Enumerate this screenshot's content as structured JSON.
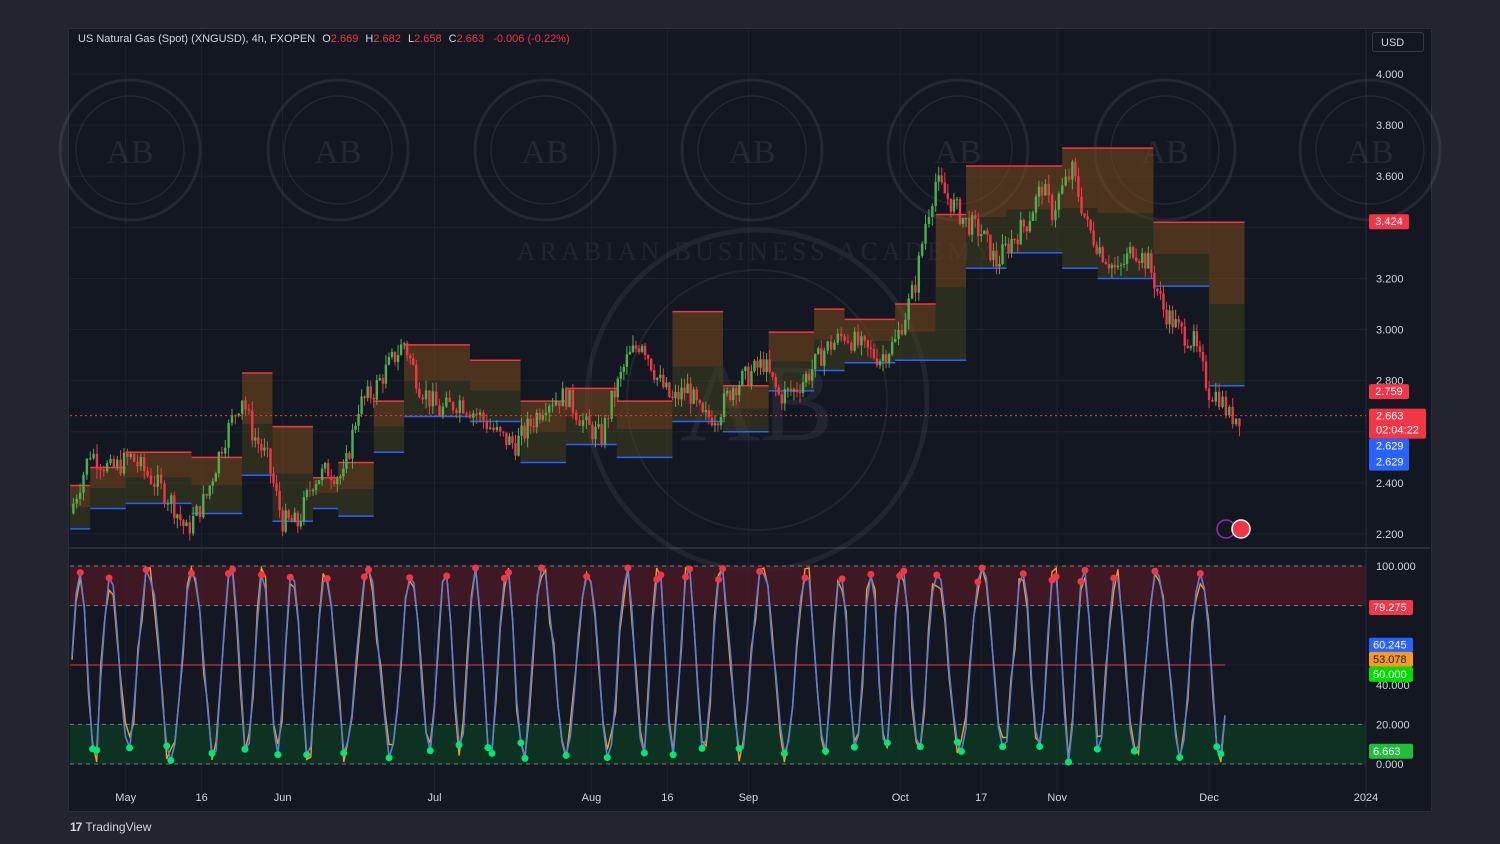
{
  "header": {
    "symbol": "US Natural Gas (Spot) (XNGUSD), 4h, FXOPEN",
    "o_label": "O",
    "o": "2.669",
    "h_label": "H",
    "h": "2.682",
    "l_label": "L",
    "l": "2.658",
    "c_label": "C",
    "c": "2.663",
    "change": "-0.006 (-0.22%)"
  },
  "currency": "USD",
  "brand": {
    "logo": "17",
    "name": "TradingView"
  },
  "watermark": {
    "initials": "AB",
    "text": "ARABIAN BUSINESS ACADEMY"
  },
  "colors": {
    "up": "#26a69a",
    "up_candle": "#4caf50",
    "down": "#f23645",
    "bg": "#131722",
    "oscillator_k": "#5b7fd4",
    "oscillator_d": "#f59b23",
    "zone_fill": "#7a4a1a",
    "overbought_zone": "#4a1a25",
    "oversold_zone": "#0e3a22"
  },
  "chart_data": [
    {
      "type": "candlestick",
      "title": "US Natural Gas (Spot) (XNGUSD), 4h, FXOPEN",
      "ylim": [
        2.2,
        4.1
      ],
      "yticks": [
        "4.000",
        "3.800",
        "3.600",
        "3.400",
        "3.200",
        "3.000",
        "2.800",
        "2.600",
        "2.400",
        "2.200"
      ],
      "xticks": [
        "May",
        "16",
        "Jun",
        "Jul",
        "Aug",
        "16",
        "Sep",
        "Oct",
        "17",
        "Nov",
        "Dec",
        "2024"
      ],
      "xtick_dates": [
        "2023-05-01",
        "2023-05-16",
        "2023-06-01",
        "2023-07-01",
        "2023-08-01",
        "2023-08-16",
        "2023-09-01",
        "2023-10-01",
        "2023-10-17",
        "2023-11-01",
        "2023-12-01",
        "2024-01-01"
      ],
      "close_path": [
        [
          "2023-04-20",
          2.28
        ],
        [
          "2023-04-24",
          2.52
        ],
        [
          "2023-04-28",
          2.45
        ],
        [
          "2023-05-02",
          2.5
        ],
        [
          "2023-05-06",
          2.42
        ],
        [
          "2023-05-10",
          2.33
        ],
        [
          "2023-05-13",
          2.21
        ],
        [
          "2023-05-17",
          2.35
        ],
        [
          "2023-05-20",
          2.55
        ],
        [
          "2023-05-24",
          2.74
        ],
        [
          "2023-05-26",
          2.6
        ],
        [
          "2023-05-29",
          2.49
        ],
        [
          "2023-06-01",
          2.25
        ],
        [
          "2023-06-04",
          2.24
        ],
        [
          "2023-06-07",
          2.41
        ],
        [
          "2023-06-10",
          2.45
        ],
        [
          "2023-06-13",
          2.42
        ],
        [
          "2023-06-16",
          2.7
        ],
        [
          "2023-06-19",
          2.76
        ],
        [
          "2023-06-22",
          2.86
        ],
        [
          "2023-06-25",
          2.95
        ],
        [
          "2023-06-28",
          2.78
        ],
        [
          "2023-07-02",
          2.68
        ],
        [
          "2023-07-06",
          2.72
        ],
        [
          "2023-07-10",
          2.66
        ],
        [
          "2023-07-14",
          2.58
        ],
        [
          "2023-07-17",
          2.55
        ],
        [
          "2023-07-20",
          2.63
        ],
        [
          "2023-07-23",
          2.72
        ],
        [
          "2023-07-27",
          2.74
        ],
        [
          "2023-07-31",
          2.62
        ],
        [
          "2023-08-03",
          2.58
        ],
        [
          "2023-08-05",
          2.72
        ],
        [
          "2023-08-08",
          2.88
        ],
        [
          "2023-08-11",
          2.96
        ],
        [
          "2023-08-14",
          2.81
        ],
        [
          "2023-08-17",
          2.72
        ],
        [
          "2023-08-20",
          2.77
        ],
        [
          "2023-08-23",
          2.65
        ],
        [
          "2023-08-26",
          2.67
        ],
        [
          "2023-08-29",
          2.78
        ],
        [
          "2023-09-01",
          2.82
        ],
        [
          "2023-09-04",
          2.87
        ],
        [
          "2023-09-07",
          2.74
        ],
        [
          "2023-09-10",
          2.76
        ],
        [
          "2023-09-13",
          2.83
        ],
        [
          "2023-09-16",
          2.92
        ],
        [
          "2023-09-20",
          2.98
        ],
        [
          "2023-09-24",
          2.92
        ],
        [
          "2023-09-27",
          2.89
        ],
        [
          "2023-09-30",
          2.95
        ],
        [
          "2023-10-02",
          3.06
        ],
        [
          "2023-10-04",
          3.18
        ],
        [
          "2023-10-06",
          3.42
        ],
        [
          "2023-10-08",
          3.58
        ],
        [
          "2023-10-11",
          3.5
        ],
        [
          "2023-10-14",
          3.42
        ],
        [
          "2023-10-17",
          3.38
        ],
        [
          "2023-10-20",
          3.26
        ],
        [
          "2023-10-23",
          3.35
        ],
        [
          "2023-10-26",
          3.42
        ],
        [
          "2023-10-29",
          3.56
        ],
        [
          "2023-10-31",
          3.46
        ],
        [
          "2023-11-02",
          3.55
        ],
        [
          "2023-11-04",
          3.62
        ],
        [
          "2023-11-07",
          3.4
        ],
        [
          "2023-11-10",
          3.3
        ],
        [
          "2023-11-13",
          3.22
        ],
        [
          "2023-11-16",
          3.32
        ],
        [
          "2023-11-19",
          3.26
        ],
        [
          "2023-11-22",
          3.08
        ],
        [
          "2023-11-25",
          3.0
        ],
        [
          "2023-11-28",
          2.95
        ],
        [
          "2023-12-01",
          2.76
        ],
        [
          "2023-12-03",
          2.74
        ],
        [
          "2023-12-05",
          2.66
        ],
        [
          "2023-12-07",
          2.663
        ]
      ],
      "zones": [
        {
          "start": "2023-04-20",
          "end": "2023-04-24",
          "high": 2.39,
          "low": 2.22
        },
        {
          "start": "2023-04-24",
          "end": "2023-05-01",
          "high": 2.46,
          "low": 2.3
        },
        {
          "start": "2023-05-01",
          "end": "2023-05-14",
          "high": 2.52,
          "low": 2.32
        },
        {
          "start": "2023-05-14",
          "end": "2023-05-24",
          "high": 2.5,
          "low": 2.28
        },
        {
          "start": "2023-05-24",
          "end": "2023-05-30",
          "high": 2.83,
          "low": 2.43
        },
        {
          "start": "2023-05-30",
          "end": "2023-06-07",
          "high": 2.62,
          "low": 2.25
        },
        {
          "start": "2023-06-07",
          "end": "2023-06-12",
          "high": 2.42,
          "low": 2.3
        },
        {
          "start": "2023-06-12",
          "end": "2023-06-19",
          "high": 2.48,
          "low": 2.27
        },
        {
          "start": "2023-06-19",
          "end": "2023-06-25",
          "high": 2.72,
          "low": 2.52
        },
        {
          "start": "2023-06-25",
          "end": "2023-07-08",
          "high": 2.94,
          "low": 2.66
        },
        {
          "start": "2023-07-08",
          "end": "2023-07-18",
          "high": 2.88,
          "low": 2.64
        },
        {
          "start": "2023-07-18",
          "end": "2023-07-27",
          "high": 2.72,
          "low": 2.48
        },
        {
          "start": "2023-07-27",
          "end": "2023-08-06",
          "high": 2.77,
          "low": 2.55
        },
        {
          "start": "2023-08-06",
          "end": "2023-08-17",
          "high": 2.72,
          "low": 2.5
        },
        {
          "start": "2023-08-17",
          "end": "2023-08-27",
          "high": 3.07,
          "low": 2.64
        },
        {
          "start": "2023-08-27",
          "end": "2023-09-05",
          "high": 2.78,
          "low": 2.6
        },
        {
          "start": "2023-09-05",
          "end": "2023-09-14",
          "high": 2.99,
          "low": 2.76
        },
        {
          "start": "2023-09-14",
          "end": "2023-09-20",
          "high": 3.08,
          "low": 2.84
        },
        {
          "start": "2023-09-20",
          "end": "2023-09-30",
          "high": 3.04,
          "low": 2.87
        },
        {
          "start": "2023-09-30",
          "end": "2023-10-08",
          "high": 3.1,
          "low": 2.88
        },
        {
          "start": "2023-10-08",
          "end": "2023-10-14",
          "high": 3.45,
          "low": 2.88
        },
        {
          "start": "2023-10-14",
          "end": "2023-10-22",
          "high": 3.64,
          "low": 3.24
        },
        {
          "start": "2023-10-22",
          "end": "2023-11-02",
          "high": 3.64,
          "low": 3.3
        },
        {
          "start": "2023-11-02",
          "end": "2023-11-09",
          "high": 3.71,
          "low": 3.24
        },
        {
          "start": "2023-11-09",
          "end": "2023-11-20",
          "high": 3.71,
          "low": 3.2
        },
        {
          "start": "2023-11-20",
          "end": "2023-12-01",
          "high": 3.42,
          "low": 3.17
        },
        {
          "start": "2023-12-01",
          "end": "2023-12-08",
          "high": 3.42,
          "low": 2.78
        }
      ],
      "last_price": "2.663",
      "countdown": "02:04:22",
      "price_tags": [
        "3.424",
        "2.759",
        "2.629",
        "2.629"
      ],
      "tag_colors": [
        "#f23645",
        "#f23645",
        "#2962ff",
        "#2962ff"
      ]
    },
    {
      "type": "line",
      "title": "",
      "ylim": [
        0,
        100
      ],
      "yticks": [
        "100.000",
        "80.000",
        "60.000",
        "40.000",
        "20.000",
        "0.000"
      ],
      "levels": [
        100,
        80,
        50,
        20,
        0
      ],
      "overbought": [
        80,
        100
      ],
      "oversold": [
        0,
        20
      ],
      "series": [
        {
          "color": "#5b7fd4",
          "last": "60.245"
        },
        {
          "color": "#f59b23",
          "last": "53.078"
        }
      ],
      "midline": "50.000",
      "tags": [
        "79.275",
        "60.245",
        "53.078",
        "50.000",
        "6.663"
      ],
      "tag_colors": [
        "#f23645",
        "#2962ff",
        "#f59b23",
        "#00e000",
        "#1fbf3a"
      ]
    }
  ]
}
